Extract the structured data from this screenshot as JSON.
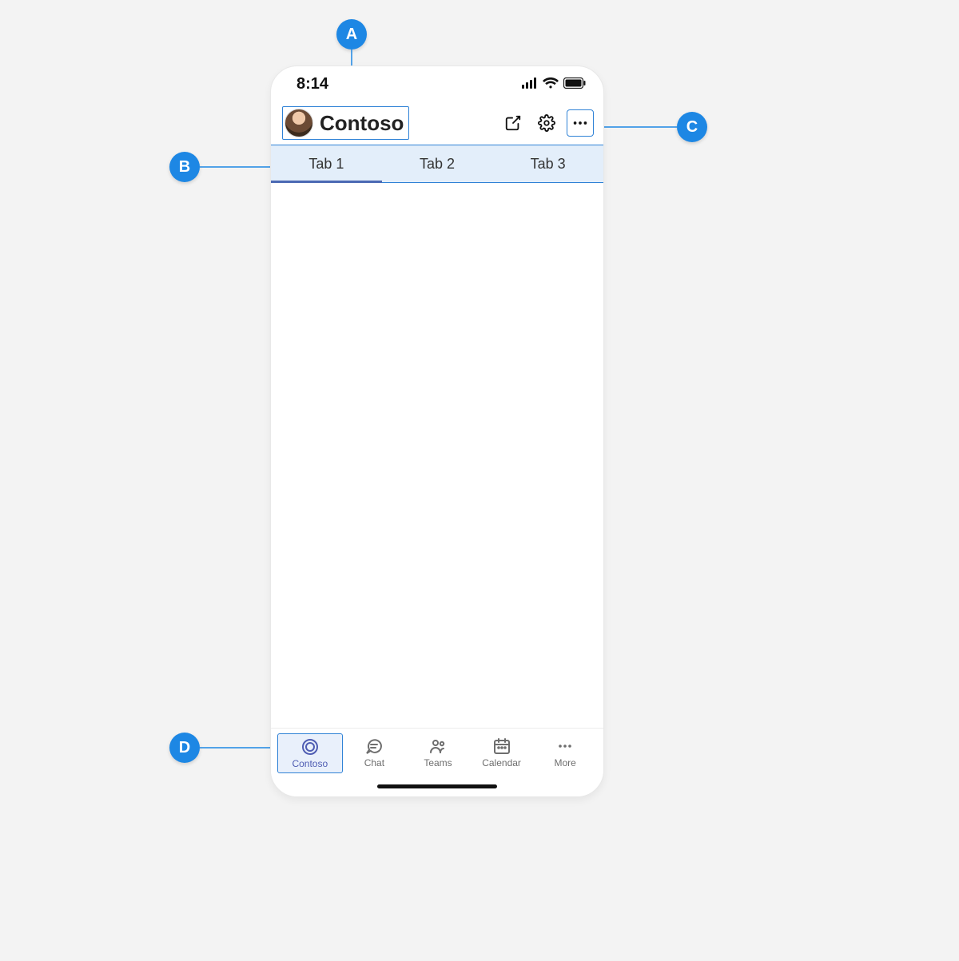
{
  "callouts": {
    "a": "A",
    "b": "B",
    "c": "C",
    "d": "D"
  },
  "status_bar": {
    "time": "8:14"
  },
  "header": {
    "app_title": "Contoso"
  },
  "tabs": {
    "items": [
      {
        "label": "Tab 1",
        "active": true
      },
      {
        "label": "Tab 2",
        "active": false
      },
      {
        "label": "Tab 3",
        "active": false
      }
    ]
  },
  "bottom_nav": {
    "items": [
      {
        "label": "Contoso",
        "icon": "contoso",
        "active": true
      },
      {
        "label": "Chat",
        "icon": "chat",
        "active": false
      },
      {
        "label": "Teams",
        "icon": "teams",
        "active": false
      },
      {
        "label": "Calendar",
        "icon": "calendar",
        "active": false
      },
      {
        "label": "More",
        "icon": "more",
        "active": false
      }
    ]
  },
  "colors": {
    "callout_blue": "#1d87e4",
    "highlight_border": "#2f82d6",
    "tab_background": "#e3eefa",
    "tab_indicator": "#4b69b3",
    "nav_active": "#4f5db3"
  }
}
